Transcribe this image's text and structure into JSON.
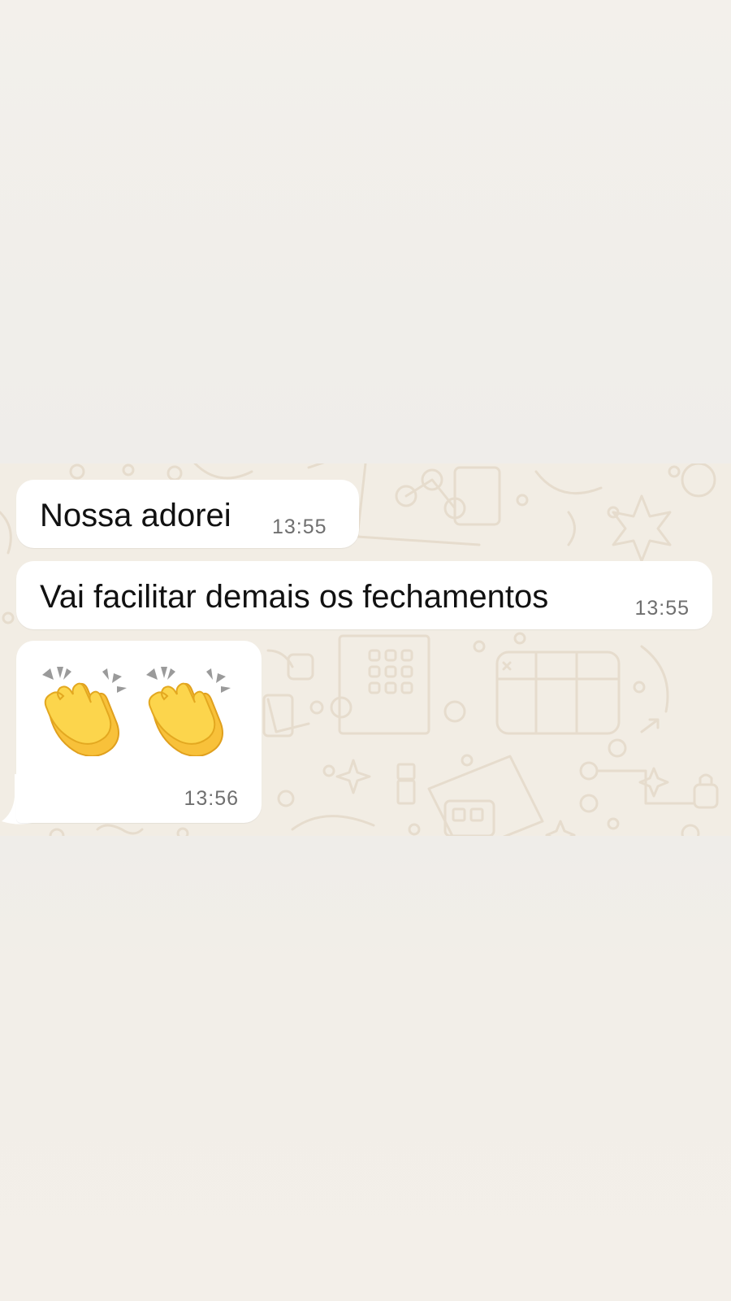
{
  "messages": [
    {
      "text": "Nossa adorei",
      "time": "13:55"
    },
    {
      "text": "Vai facilitar demais os fechamentos",
      "time": "13:55"
    },
    {
      "emoji": [
        "clapping-hands-emoji",
        "clapping-hands-emoji"
      ],
      "time": "13:56"
    }
  ],
  "colors": {
    "chat_background": "#f2ede4",
    "bubble": "#ffffff",
    "text": "#111111",
    "timestamp": "#6f6f6f",
    "emoji_yellow": "#f8c13a"
  }
}
